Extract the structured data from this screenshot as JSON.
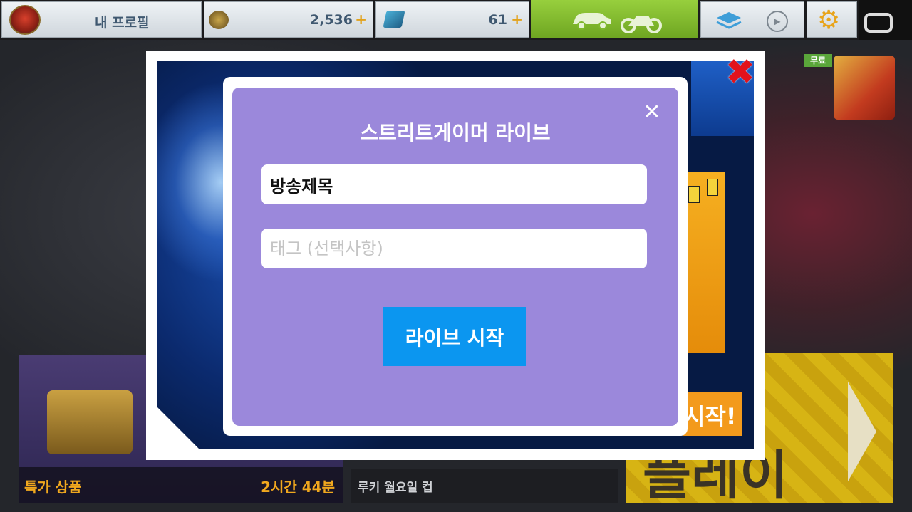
{
  "topbar": {
    "profile_label": "내 프로필",
    "cash_value": "2,536",
    "cash_plus": "+",
    "tokens_value": "61",
    "tokens_plus": "+"
  },
  "tiles": {
    "special_offer_label": "특가 상품",
    "special_offer_timer": "2시간 44분",
    "rookie_cup_label": "루키 월요일 컵",
    "play_label": "플레이",
    "free_badge": "무료"
  },
  "event_popup": {
    "start_badge": "시작!",
    "close_symbol": "✖"
  },
  "live_dialog": {
    "title": "스트리트게이머 라이브",
    "close_symbol": "✕",
    "broadcast_title_value": "방송제목",
    "tags_placeholder": "태그 (선택사항)",
    "start_button_label": "라이브 시작"
  },
  "colors": {
    "dialog_panel": "#9b88db",
    "start_button": "#0b96f0",
    "event_close": "#e3121b",
    "accent_orange": "#f0a81e",
    "garage_green": "#7fb82d"
  }
}
